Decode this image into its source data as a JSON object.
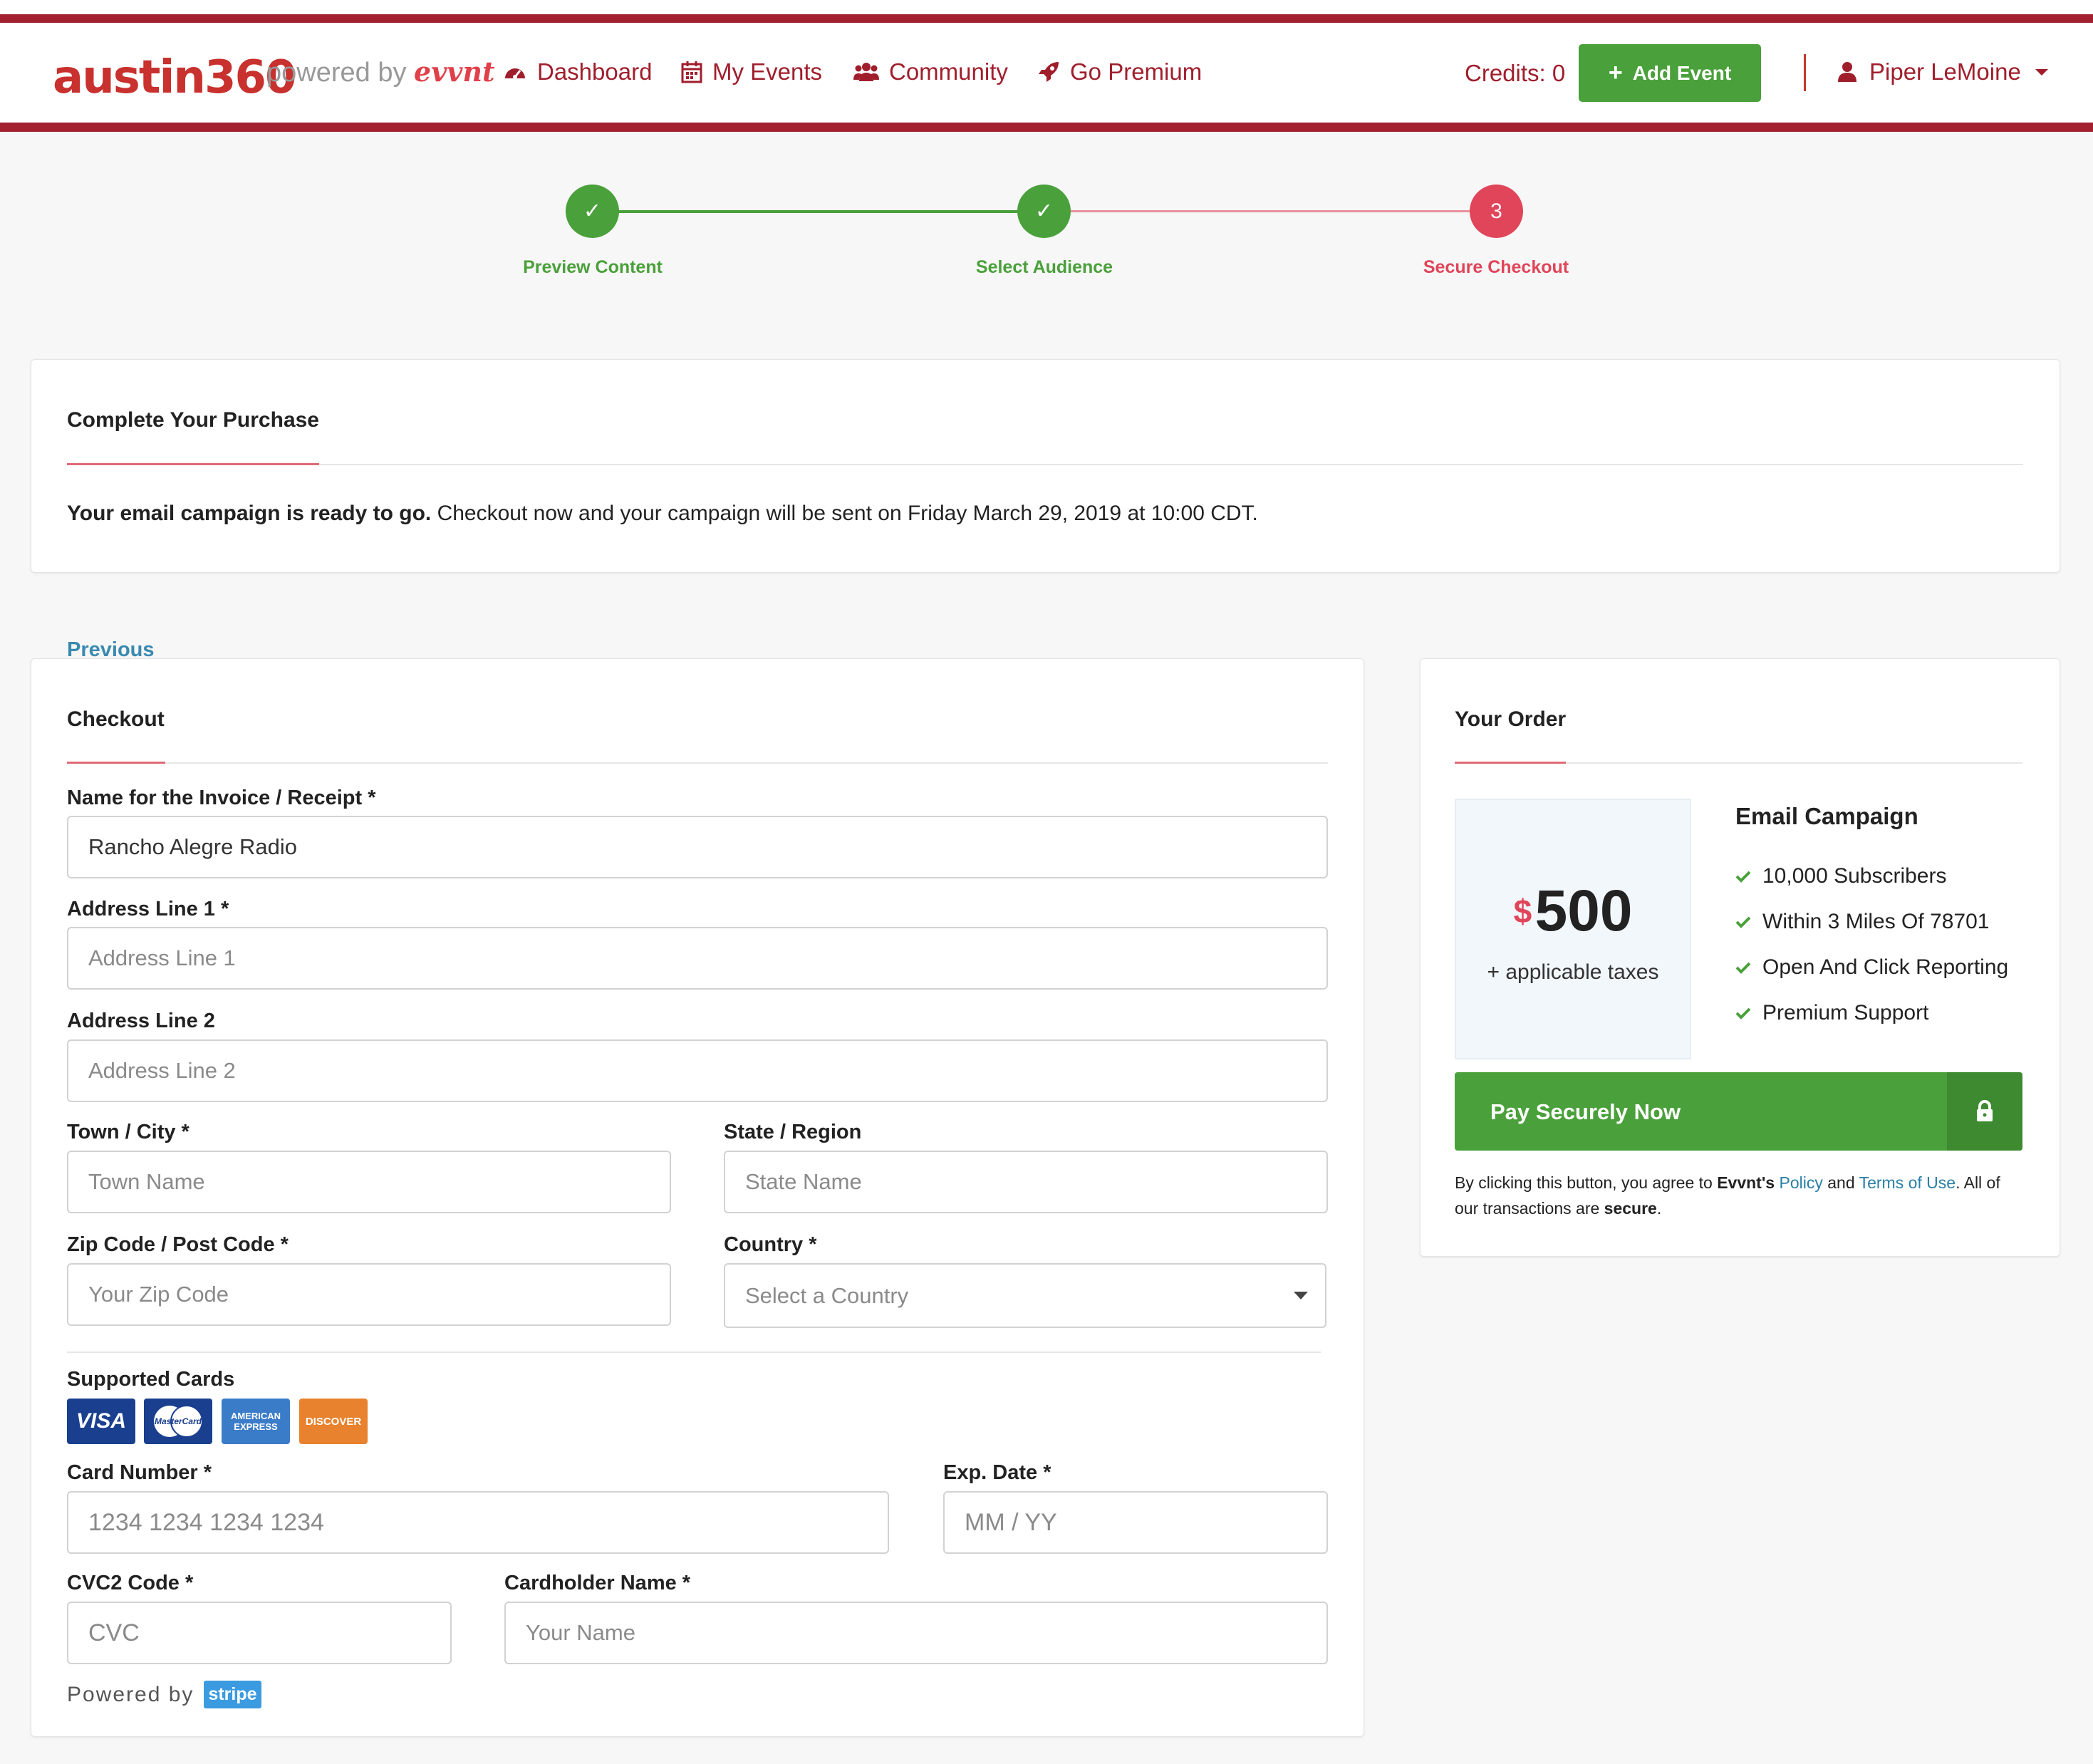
{
  "header": {
    "logo": "austin360",
    "powered_prefix": "powered by",
    "powered_brand": "evvnt",
    "nav": [
      {
        "label": "Dashboard",
        "icon": "dashboard-icon"
      },
      {
        "label": "My Events",
        "icon": "calendar-icon"
      },
      {
        "label": "Community",
        "icon": "users-icon"
      },
      {
        "label": "Go Premium",
        "icon": "rocket-icon"
      }
    ],
    "credits": "Credits: 0",
    "add_event": "Add Event",
    "user_name": "Piper LeMoine"
  },
  "steps": [
    {
      "label": "Preview Content",
      "state": "done",
      "mark": "✓"
    },
    {
      "label": "Select Audience",
      "state": "done",
      "mark": "✓"
    },
    {
      "label": "Secure Checkout",
      "state": "current",
      "mark": "3"
    }
  ],
  "purchase": {
    "title": "Complete Your Purchase",
    "message_bold": "Your email campaign is ready to go.",
    "message_rest": " Checkout now and your campaign will be sent on Friday March 29, 2019 at 10:00 CDT."
  },
  "previous_link": "Previous",
  "checkout": {
    "title": "Checkout",
    "invoice_name_label": "Name for the Invoice / Receipt *",
    "invoice_name_value": "Rancho Alegre Radio",
    "address1_label": "Address Line 1 *",
    "address1_placeholder": "Address Line 1",
    "address2_label": "Address Line 2",
    "address2_placeholder": "Address Line 2",
    "city_label": "Town / City *",
    "city_placeholder": "Town Name",
    "state_label": "State / Region",
    "state_placeholder": "State Name",
    "zip_label": "Zip Code / Post Code *",
    "zip_placeholder": "Your Zip Code",
    "country_label": "Country *",
    "country_placeholder": "Select a Country",
    "supported_cards_label": "Supported Cards",
    "cards": [
      "VISA",
      "MasterCard",
      "AMERICAN EXPRESS",
      "DISCOVER"
    ],
    "card_number_label": "Card Number *",
    "card_number_placeholder": "1234 1234 1234 1234",
    "exp_label": "Exp. Date *",
    "exp_placeholder": "MM / YY",
    "cvc_label": "CVC2 Code *",
    "cvc_placeholder": "CVC",
    "cardholder_label": "Cardholder Name *",
    "cardholder_placeholder": "Your Name",
    "powered_by": "Powered by",
    "stripe": "stripe"
  },
  "order": {
    "title": "Your Order",
    "currency": "$",
    "price": "500",
    "taxes": "+ applicable taxes",
    "product": "Email Campaign",
    "features": [
      "10,000 Subscribers",
      "Within 3 Miles Of 78701",
      "Open And Click Reporting",
      "Premium Support"
    ],
    "pay_button": "Pay Securely Now",
    "terms_1": "By clicking this button, you agree to ",
    "terms_brand": "Evvnt's",
    "terms_policy": "Policy",
    "terms_and": " and ",
    "terms_tou": "Terms of Use",
    "terms_2": ". All of our transactions are ",
    "terms_secure": "secure",
    "terms_end": "."
  },
  "colors": {
    "brand_red": "#a32030",
    "success_green": "#4aa03a",
    "step_current": "#e0455a",
    "link_blue": "#2a7fa6"
  }
}
